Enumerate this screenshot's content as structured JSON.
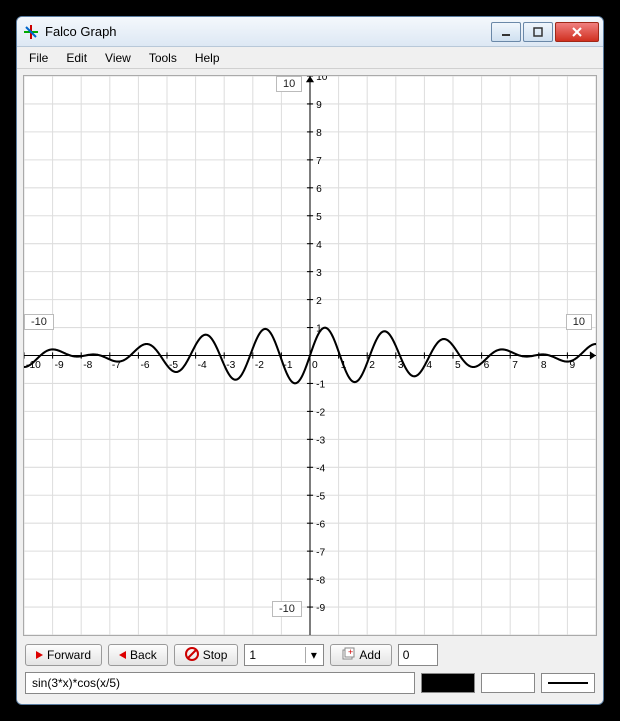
{
  "window": {
    "title": "Falco Graph"
  },
  "menu": {
    "items": [
      "File",
      "Edit",
      "View",
      "Tools",
      "Help"
    ]
  },
  "graph": {
    "y_top_box": "10",
    "y_bottom_box": "-10",
    "x_left_box": "-10",
    "x_right_box": "10",
    "y_ticks_upper": [
      "10",
      "9",
      "8",
      "7",
      "6",
      "5",
      "4",
      "3",
      "2",
      "1"
    ],
    "y_ticks_lower": [
      "-1",
      "-2",
      "-3",
      "-4",
      "-5",
      "-6",
      "-7",
      "-8",
      "-9"
    ],
    "x_ticks_neg": [
      "-10",
      "-9",
      "-8",
      "-7",
      "-6",
      "-5",
      "-4",
      "-3",
      "-2",
      "-1"
    ],
    "x_ticks_pos": [
      "0",
      "1",
      "2",
      "3",
      "4",
      "5",
      "6",
      "7",
      "8",
      "9"
    ]
  },
  "toolbar": {
    "forward": "Forward",
    "back": "Back",
    "stop": "Stop",
    "select_value": "1",
    "add": "Add",
    "count": "0"
  },
  "bottombar": {
    "formula": "sin(3*x)*cos(x/5)"
  },
  "chart_data": {
    "type": "line",
    "title": "",
    "xlabel": "",
    "ylabel": "",
    "xlim": [
      -10,
      10
    ],
    "ylim": [
      -10,
      10
    ],
    "function": "sin(3*x)*cos(x/5)",
    "series": [
      {
        "name": "sin(3*x)*cos(x/5)",
        "x_range": [
          -10,
          10
        ],
        "sample_y_at_integer_x": {
          "-10": 0.41,
          "-9": 0.44,
          "-8": -0.03,
          "-7": -0.15,
          "-6": 0.27,
          "-5": -0.35,
          "-4": 0.37,
          "-3": -0.34,
          "-2": 0.26,
          "-1": -0.14,
          "0": 0.0,
          "1": -0.14,
          "2": 0.26,
          "3": -0.34,
          "4": 0.37,
          "5": -0.35,
          "6": 0.27,
          "7": -0.15,
          "8": -0.03,
          "9": 0.44,
          "10": 0.41
        },
        "amplitude_envelope": "cos(x/5)",
        "approx_max_abs": 1.0
      }
    ],
    "grid": true
  }
}
